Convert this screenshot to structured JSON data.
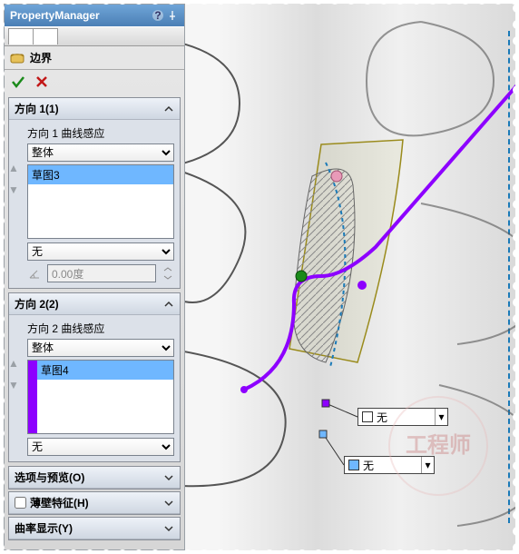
{
  "titlebar": {
    "title": "PropertyManager"
  },
  "feature": {
    "label": "边界"
  },
  "dir1": {
    "title": "方向 1(1)",
    "label": "方向 1 曲线感应",
    "type_select": "整体",
    "item": "草图3",
    "end_select": "无",
    "angle": "0.00度"
  },
  "dir2": {
    "title": "方向 2(2)",
    "label": "方向 2 曲线感应",
    "type_select": "整体",
    "item": "草图4",
    "end_select": "无"
  },
  "sections": {
    "options": "选项与预览(O)",
    "thin": "薄壁特征(H)",
    "curv": "曲率显示(Y)"
  },
  "callouts": {
    "purple": "无",
    "blue": "无"
  },
  "colors": {
    "purple": "#8d00ff",
    "blue": "#6fb7ff",
    "axis": "#1a7ab8"
  },
  "watermark": "工程师"
}
